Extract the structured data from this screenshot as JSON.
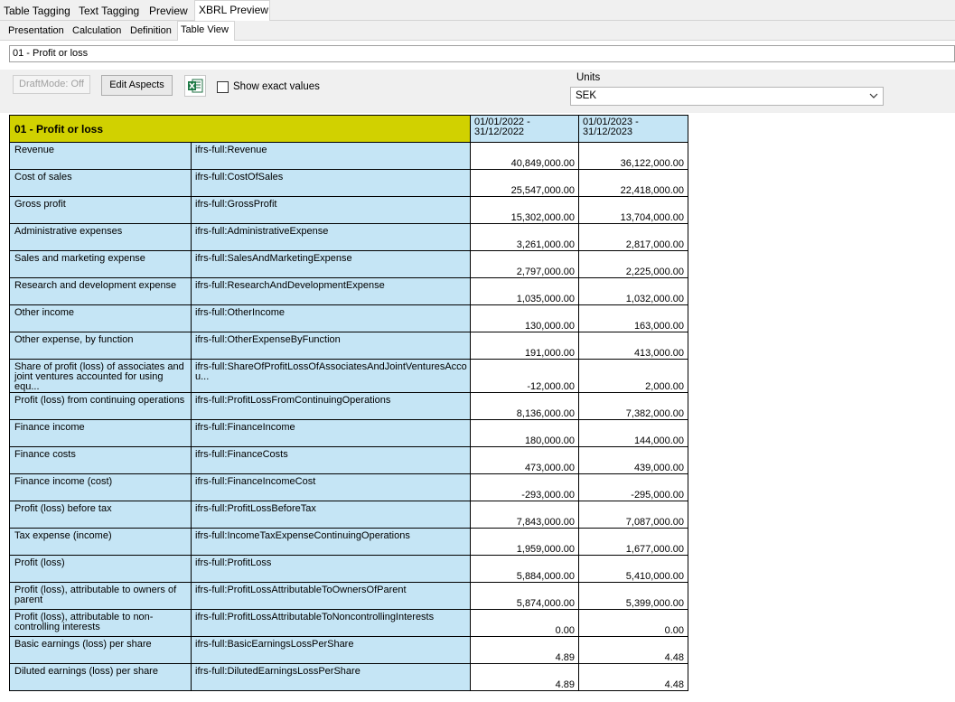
{
  "tabs_top": [
    "Table Tagging",
    "Text Tagging",
    "Preview",
    "XBRL Preview"
  ],
  "tabs_sub": [
    "Presentation",
    "Calculation",
    "Definition",
    "Table View"
  ],
  "selector": "01 - Profit or loss",
  "toolbar": {
    "draft_mode": "DraftMode: Off",
    "edit_aspects": "Edit Aspects",
    "excel_icon": "excel-icon",
    "show_exact_values": "Show exact values",
    "units_label": "Units",
    "units_value": "SEK"
  },
  "table": {
    "title": "01 - Profit or loss",
    "periods": [
      "01/01/2022 - 31/12/2022",
      "01/01/2023 - 31/12/2023"
    ],
    "rows": [
      {
        "label": "Revenue",
        "concept": "ifrs-full:Revenue",
        "v1": "40,849,000.00",
        "v2": "36,122,000.00"
      },
      {
        "label": "Cost of sales",
        "concept": "ifrs-full:CostOfSales",
        "v1": "25,547,000.00",
        "v2": "22,418,000.00"
      },
      {
        "label": "Gross profit",
        "concept": "ifrs-full:GrossProfit",
        "v1": "15,302,000.00",
        "v2": "13,704,000.00"
      },
      {
        "label": "Administrative expenses",
        "concept": "ifrs-full:AdministrativeExpense",
        "v1": "3,261,000.00",
        "v2": "2,817,000.00"
      },
      {
        "label": "Sales and marketing expense",
        "concept": "ifrs-full:SalesAndMarketingExpense",
        "v1": "2,797,000.00",
        "v2": "2,225,000.00"
      },
      {
        "label": "Research and development expense",
        "concept": "ifrs-full:ResearchAndDevelopmentExpense",
        "v1": "1,035,000.00",
        "v2": "1,032,000.00"
      },
      {
        "label": "Other income",
        "concept": "ifrs-full:OtherIncome",
        "v1": "130,000.00",
        "v2": "163,000.00"
      },
      {
        "label": "Other expense, by function",
        "concept": "ifrs-full:OtherExpenseByFunction",
        "v1": "191,000.00",
        "v2": "413,000.00"
      },
      {
        "label": "Share of profit (loss) of associates and joint ventures accounted for using equ...",
        "concept": "ifrs-full:ShareOfProfitLossOfAssociatesAndJointVenturesAccou...",
        "v1": "-12,000.00",
        "v2": "2,000.00"
      },
      {
        "label": "Profit (loss) from continuing operations",
        "concept": "ifrs-full:ProfitLossFromContinuingOperations",
        "v1": "8,136,000.00",
        "v2": "7,382,000.00"
      },
      {
        "label": "Finance income",
        "concept": "ifrs-full:FinanceIncome",
        "v1": "180,000.00",
        "v2": "144,000.00"
      },
      {
        "label": "Finance costs",
        "concept": "ifrs-full:FinanceCosts",
        "v1": "473,000.00",
        "v2": "439,000.00"
      },
      {
        "label": "Finance income (cost)",
        "concept": "ifrs-full:FinanceIncomeCost",
        "v1": "-293,000.00",
        "v2": "-295,000.00"
      },
      {
        "label": "Profit (loss) before tax",
        "concept": "ifrs-full:ProfitLossBeforeTax",
        "v1": "7,843,000.00",
        "v2": "7,087,000.00"
      },
      {
        "label": "Tax expense (income)",
        "concept": "ifrs-full:IncomeTaxExpenseContinuingOperations",
        "v1": "1,959,000.00",
        "v2": "1,677,000.00"
      },
      {
        "label": "Profit (loss)",
        "concept": "ifrs-full:ProfitLoss",
        "v1": "5,884,000.00",
        "v2": "5,410,000.00"
      },
      {
        "label": "Profit (loss), attributable to owners of parent",
        "concept": "ifrs-full:ProfitLossAttributableToOwnersOfParent",
        "v1": "5,874,000.00",
        "v2": "5,399,000.00"
      },
      {
        "label": "Profit (loss), attributable to non-controlling interests",
        "concept": "ifrs-full:ProfitLossAttributableToNoncontrollingInterests",
        "v1": "0.00",
        "v2": "0.00"
      },
      {
        "label": "Basic earnings (loss) per share",
        "concept": "ifrs-full:BasicEarningsLossPerShare",
        "v1": "4.89",
        "v2": "4.48"
      },
      {
        "label": "Diluted earnings (loss) per share",
        "concept": "ifrs-full:DilutedEarningsLossPerShare",
        "v1": "4.89",
        "v2": "4.48"
      }
    ]
  }
}
